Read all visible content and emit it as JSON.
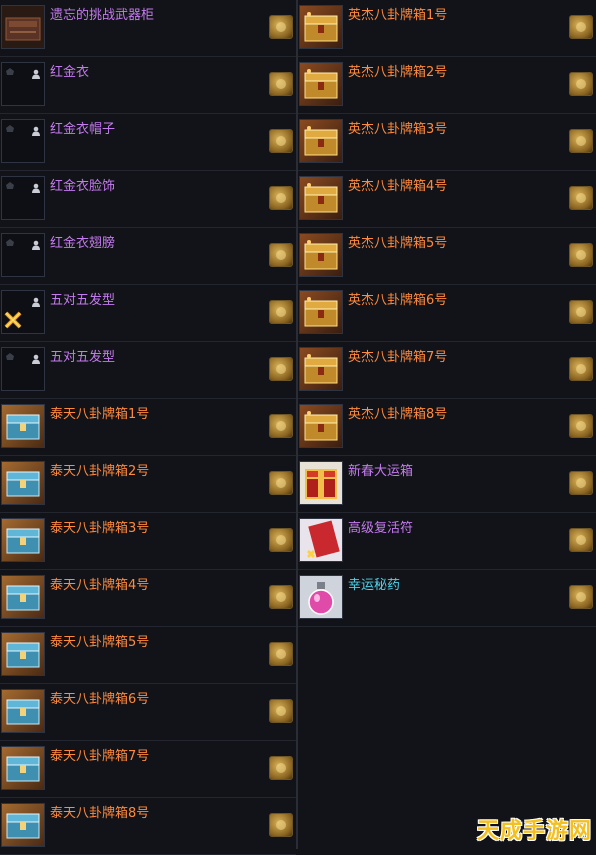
{
  "colors": {
    "purple": "#c57bf0",
    "orange": "#ff8a3c",
    "cyan": "#4fd2e8"
  },
  "left_items": [
    {
      "name": "遗忘的挑战武器柜",
      "color": "purple",
      "icon": "weapon-cabinet-icon",
      "bound": false
    },
    {
      "name": "红金衣",
      "color": "purple",
      "icon": "empty-slot-icon",
      "bound": true
    },
    {
      "name": "红金衣帽子",
      "color": "purple",
      "icon": "empty-slot-icon",
      "bound": true
    },
    {
      "name": "红金衣脸饰",
      "color": "purple",
      "icon": "empty-slot-icon",
      "bound": true
    },
    {
      "name": "红金衣翅膀",
      "color": "purple",
      "icon": "empty-slot-icon",
      "bound": true
    },
    {
      "name": "五对五发型",
      "color": "purple",
      "icon": "crossed-swords-icon",
      "bound": true
    },
    {
      "name": "五对五发型",
      "color": "purple",
      "icon": "empty-slot-icon",
      "bound": true
    },
    {
      "name": "泰天八卦牌箱1号",
      "color": "orange",
      "icon": "blue-chest-icon",
      "bound": false
    },
    {
      "name": "泰天八卦牌箱2号",
      "color": "orange",
      "icon": "blue-chest-icon",
      "bound": false
    },
    {
      "name": "泰天八卦牌箱3号",
      "color": "orange",
      "icon": "blue-chest-icon",
      "bound": false
    },
    {
      "name": "泰天八卦牌箱4号",
      "color": "orange",
      "icon": "blue-chest-icon",
      "bound": false
    },
    {
      "name": "泰天八卦牌箱5号",
      "color": "orange",
      "icon": "blue-chest-icon",
      "bound": false
    },
    {
      "name": "泰天八卦牌箱6号",
      "color": "orange",
      "icon": "blue-chest-icon",
      "bound": false
    },
    {
      "name": "泰天八卦牌箱7号",
      "color": "orange",
      "icon": "blue-chest-icon",
      "bound": false
    },
    {
      "name": "泰天八卦牌箱8号",
      "color": "orange",
      "icon": "blue-chest-icon",
      "bound": false
    }
  ],
  "right_items": [
    {
      "name": "英杰八卦牌箱1号",
      "color": "orange",
      "icon": "gold-chest-icon",
      "bound": false
    },
    {
      "name": "英杰八卦牌箱2号",
      "color": "orange",
      "icon": "gold-chest-icon",
      "bound": false
    },
    {
      "name": "英杰八卦牌箱3号",
      "color": "orange",
      "icon": "gold-chest-icon",
      "bound": false
    },
    {
      "name": "英杰八卦牌箱4号",
      "color": "orange",
      "icon": "gold-chest-icon",
      "bound": false
    },
    {
      "name": "英杰八卦牌箱5号",
      "color": "orange",
      "icon": "gold-chest-icon",
      "bound": false
    },
    {
      "name": "英杰八卦牌箱6号",
      "color": "orange",
      "icon": "gold-chest-icon",
      "bound": false
    },
    {
      "name": "英杰八卦牌箱7号",
      "color": "orange",
      "icon": "gold-chest-icon",
      "bound": false
    },
    {
      "name": "英杰八卦牌箱8号",
      "color": "orange",
      "icon": "gold-chest-icon",
      "bound": false
    },
    {
      "name": "新春大运箱",
      "color": "purple",
      "icon": "lucky-box-icon",
      "bound": false
    },
    {
      "name": "高级复活符",
      "color": "purple",
      "icon": "revive-talisman-icon",
      "bound": false
    },
    {
      "name": "幸运秘药",
      "color": "cyan",
      "icon": "potion-icon",
      "bound": false
    }
  ],
  "watermark": "天成手游网"
}
